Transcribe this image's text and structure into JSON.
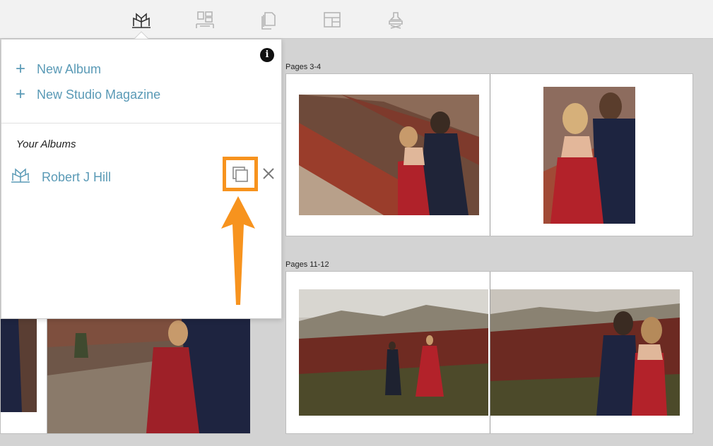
{
  "toolbar": {
    "icons": [
      "album-book-icon",
      "layout-icon",
      "pages-icon",
      "template-icon",
      "stamp-icon"
    ]
  },
  "spreads": [
    {
      "label": "Pages 3-4"
    },
    {
      "label": "Pages 11-12"
    }
  ],
  "popover": {
    "info_label": "i",
    "menu": [
      {
        "icon": "+",
        "label": "New Album"
      },
      {
        "icon": "+",
        "label": "New Studio Magazine"
      }
    ],
    "section_title": "Your Albums",
    "albums": [
      {
        "name": "Robert J Hill",
        "icon": "album-book-icon",
        "actions": [
          "duplicate-icon",
          "close-icon"
        ]
      }
    ]
  },
  "annotation": {
    "highlight_color": "#f7931e",
    "arrow_color": "#f7931e"
  },
  "colors": {
    "accent": "#5a9ab6",
    "background": "#d3d3d3",
    "toolbar": "#f2f2f2"
  }
}
